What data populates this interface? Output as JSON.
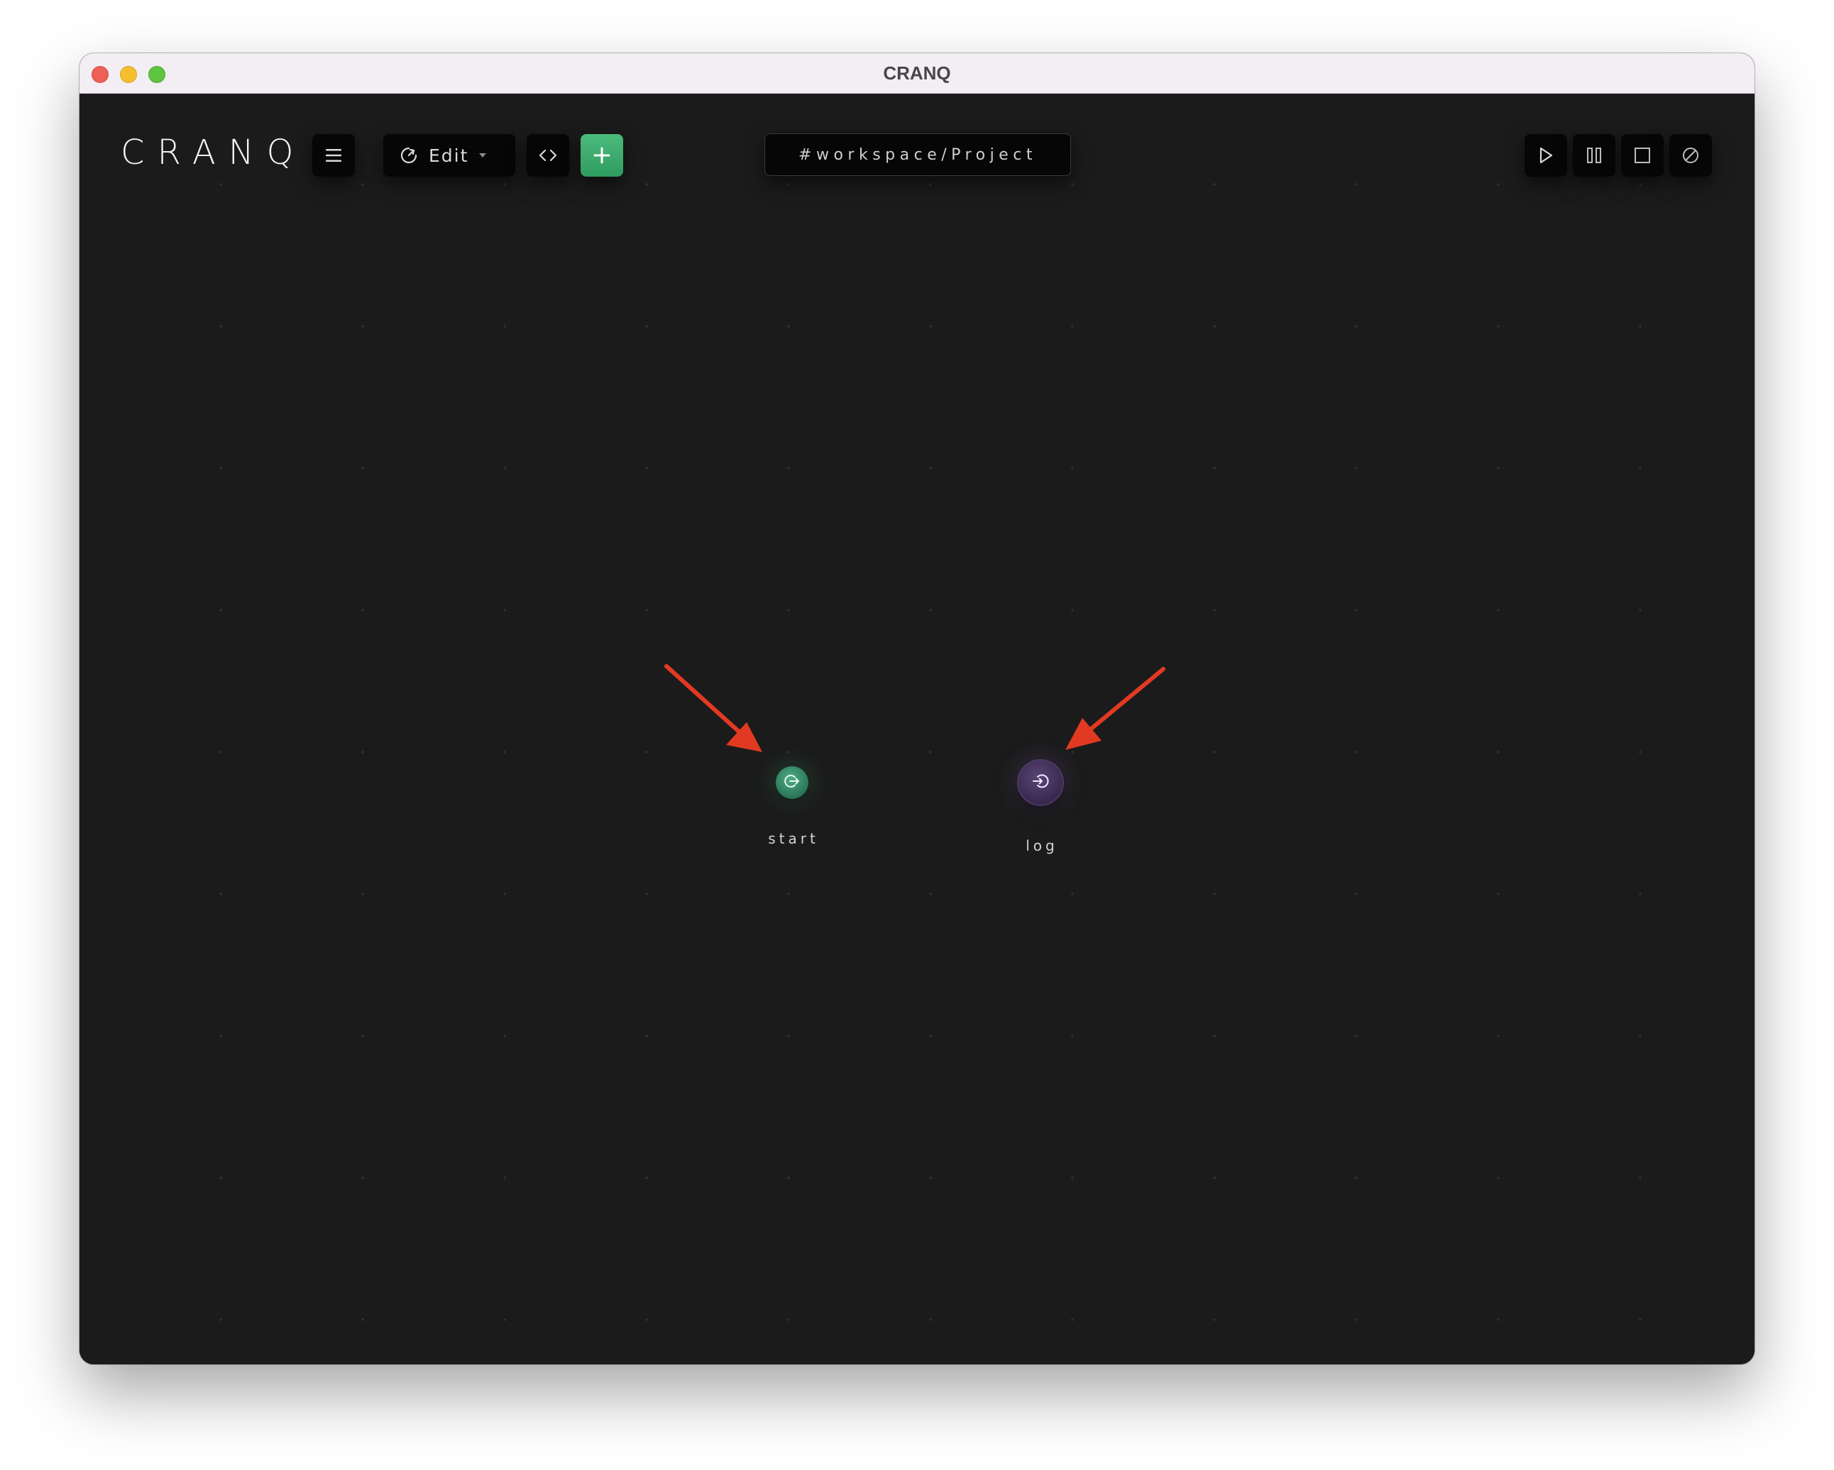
{
  "window": {
    "title": "CRANQ"
  },
  "toolbar": {
    "logo": "CRANQ",
    "menu_icon": "hamburger-icon",
    "mode_label": "Edit",
    "mode_icon": "mode-dial-icon",
    "code_icon": "code-brackets-icon",
    "add_icon": "plus-icon",
    "add_color": "#3fae6e",
    "path": "#workspace/Project"
  },
  "run_controls": [
    {
      "name": "run",
      "icon": "play-icon"
    },
    {
      "name": "pause",
      "icon": "pause-icon"
    },
    {
      "name": "stop",
      "icon": "stop-icon"
    },
    {
      "name": "clear",
      "icon": "clear-icon"
    }
  ],
  "canvas": {
    "nodes": [
      {
        "label": "start",
        "icon": "exit-icon",
        "color": "#3a8d6c"
      },
      {
        "label": "log",
        "icon": "enter-icon",
        "color": "#45345e"
      }
    ],
    "annotation_color": "#e23a22"
  }
}
